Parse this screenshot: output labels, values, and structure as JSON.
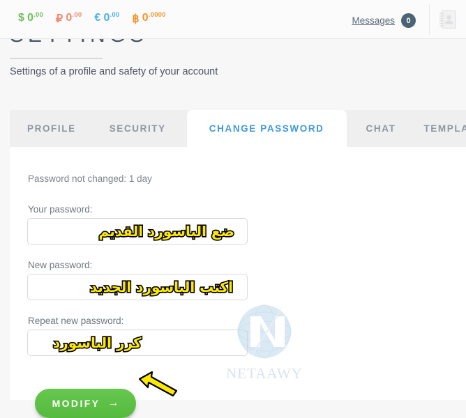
{
  "topbar": {
    "wallets": [
      {
        "name": "usd",
        "symbol": "$",
        "integer": "0",
        "fraction": ".00",
        "color": "#6bbf59"
      },
      {
        "name": "rub",
        "symbol": "₽",
        "integer": "0",
        "fraction": ".00",
        "color": "#f08a72"
      },
      {
        "name": "eur",
        "symbol": "€",
        "integer": "0",
        "fraction": ".00",
        "color": "#4fb0e8"
      },
      {
        "name": "btc",
        "symbol": "฿",
        "integer": "0",
        "fraction": ".0000",
        "color": "#f2962f"
      }
    ],
    "messages_label": "Messages",
    "messages_count": "0",
    "contacts_icon": "address-book-icon"
  },
  "header": {
    "title": "SETTINGS",
    "subtitle": "Settings of a profile and safety of your account"
  },
  "panel": {
    "tabs": [
      {
        "label": "PROFILE",
        "active": false
      },
      {
        "label": "SECURITY",
        "active": false
      },
      {
        "label": "CHANGE PASSWORD",
        "active": true
      },
      {
        "label": "CHAT",
        "active": false
      },
      {
        "label": "TEMPLATES",
        "active": false
      }
    ],
    "active_tab_color": "#3f9ada",
    "inactive_tab_color": "#8e969f"
  },
  "form": {
    "notice": "Password not changed: 1 day",
    "fields": [
      {
        "label": "Your password:",
        "value": "",
        "placeholder": "",
        "annotation": "ضع الباسورد القديم"
      },
      {
        "label": "New password:",
        "value": "",
        "placeholder": "",
        "annotation": "اكتب الباسورد الجديد"
      },
      {
        "label": "Repeat new password:",
        "value": "",
        "placeholder": "",
        "annotation": "كرر الباسورد"
      }
    ],
    "submit_label": "MODIFY",
    "submit_arrow": "→",
    "submit_color": "#5cbf45"
  },
  "annotations": {
    "arrow_color": "#ffe800",
    "arrow_points_to": "modify-button"
  },
  "watermark": {
    "text": "NETAAWY",
    "color": "#b8cfe0"
  }
}
